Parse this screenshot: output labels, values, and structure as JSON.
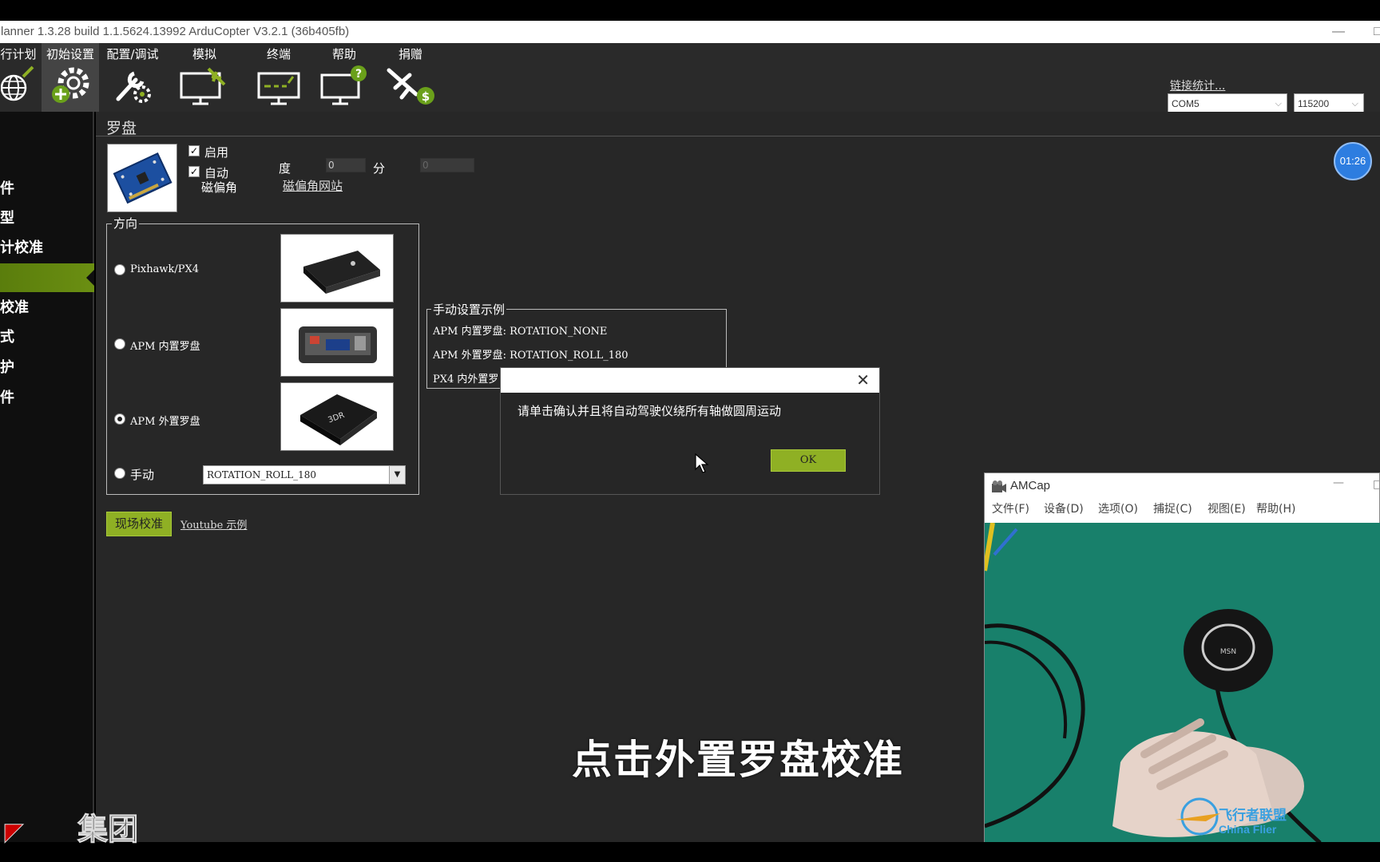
{
  "window": {
    "title": "lanner 1.3.28 build 1.1.5624.13992 ArduCopter V3.2.1 (36b405fb)",
    "minimize_glyph": "—",
    "restore_glyph": "□"
  },
  "toolbar": {
    "items": [
      {
        "label": "行计划",
        "icon": "flight-plan-globe-icon"
      },
      {
        "label": "初始设置",
        "icon": "initial-setup-gear-icon",
        "active": true
      },
      {
        "label": "配置/调试",
        "icon": "config-tuning-wrench-icon"
      },
      {
        "label": "模拟",
        "icon": "simulation-monitor-icon"
      },
      {
        "label": "终端",
        "icon": "terminal-monitor-icon"
      },
      {
        "label": "帮助",
        "icon": "help-monitor-icon"
      },
      {
        "label": "捐赠",
        "icon": "donate-plane-icon"
      }
    ],
    "com_port": "COM5",
    "baud_rate": "115200",
    "link_stats": "链接统计..."
  },
  "sidebar": {
    "items": [
      "件",
      "型",
      "计校准",
      "",
      "校准",
      "式",
      "护",
      "件"
    ]
  },
  "compass": {
    "section_title": "罗盘",
    "enable_label": "启用",
    "enable_checked": true,
    "auto_label": "自动",
    "auto_checked": true,
    "declination_label": "磁偏角",
    "degree_label": "度",
    "degree_value": "0",
    "minute_label": "分",
    "minute_value": "0",
    "declination_site_link": "磁偏角网站",
    "orientation_group_title": "方向",
    "orientation_options": [
      {
        "label": "Pixhawk/PX4",
        "selected": false
      },
      {
        "label": "APM 内置罗盘",
        "selected": false
      },
      {
        "label": "APM 外置罗盘",
        "selected": true
      },
      {
        "label": "手动",
        "selected": false
      }
    ],
    "manual_rotation_value": "ROTATION_ROLL_180",
    "calibrate_button": "现场校准",
    "youtube_link": "Youtube 示例",
    "manual_example": {
      "title": "手动设置示例",
      "lines": [
        "APM 内置罗盘: ROTATION_NONE",
        "APM 外置罗盘: ROTATION_ROLL_180",
        "PX4 内外置罗"
      ]
    }
  },
  "dialog": {
    "message": "请单击确认并且将自动驾驶仪绕所有轴做圆周运动",
    "ok_label": "OK",
    "close_glyph": "✕"
  },
  "amcap": {
    "title": "AMCap",
    "menu": [
      "文件(F)",
      "设备(D)",
      "选项(O)",
      "捕捉(C)",
      "视图(E)",
      "帮助(H)"
    ],
    "gps_label": "MSN"
  },
  "overlay": {
    "timer": "01:26",
    "subtitle": "点击外置罗盘校准",
    "logo_text": "集团",
    "watermark_cn": "飞行者联盟",
    "watermark_en": "China Flier"
  },
  "colors": {
    "accent_green": "#8fb024",
    "panel_bg": "#272727",
    "toolbar_bg": "#2a2a2a",
    "timer_blue": "#2d7de0"
  }
}
